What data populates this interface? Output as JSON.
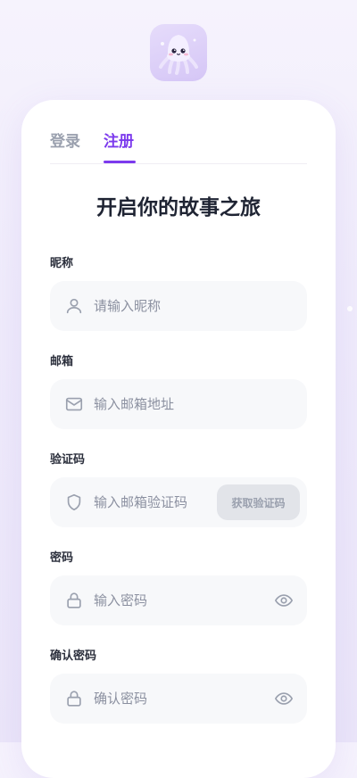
{
  "tabs": [
    {
      "label": "登录",
      "active": false
    },
    {
      "label": "注册",
      "active": true
    }
  ],
  "heading": "开启你的故事之旅",
  "fields": {
    "nickname": {
      "label": "昵称",
      "placeholder": "请输入昵称",
      "icon": "user-icon"
    },
    "email": {
      "label": "邮箱",
      "placeholder": "输入邮箱地址",
      "icon": "mail-icon"
    },
    "code": {
      "label": "验证码",
      "placeholder": "输入邮箱验证码",
      "icon": "shield-icon",
      "button_label": "获取验证码"
    },
    "password": {
      "label": "密码",
      "placeholder": "输入密码",
      "icon": "lock-icon",
      "toggle_icon": "eye-icon"
    },
    "confirm_password": {
      "label": "确认密码",
      "placeholder": "确认密码",
      "icon": "lock-icon",
      "toggle_icon": "eye-icon"
    }
  },
  "colors": {
    "accent": "#7c3aed",
    "tab_inactive": "#9aa0ae",
    "input_bg": "#f7f8fa",
    "placeholder": "#8b90a0",
    "icon": "#9aa0ae"
  }
}
